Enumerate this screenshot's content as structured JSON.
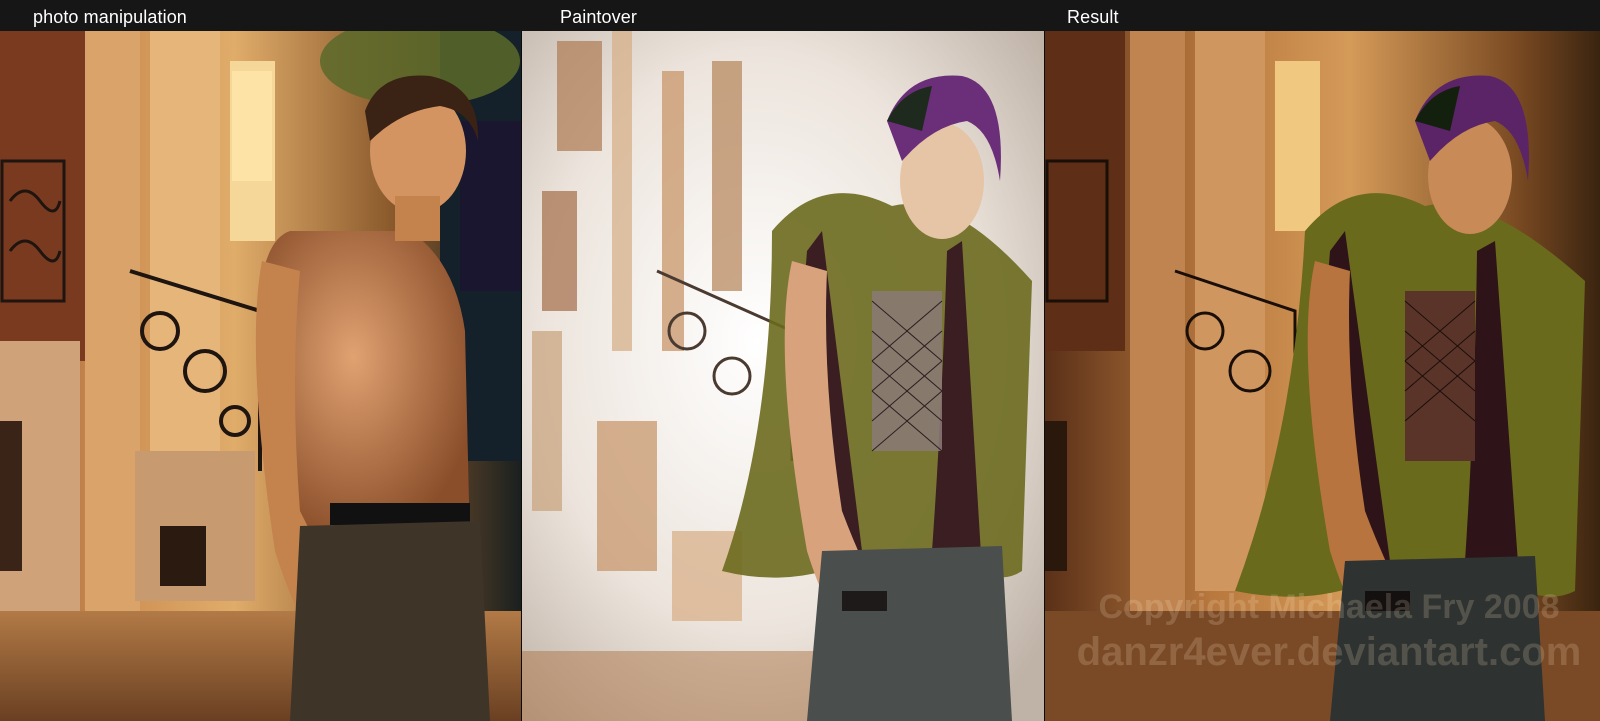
{
  "captions": {
    "photo": "photo manipulation",
    "paintover": "Paintover",
    "result": "Result"
  },
  "watermark": {
    "line1": "Copyright Michaela Fry 2008",
    "line2": "danzr4ever.deviantart.com"
  },
  "colors": {
    "header_bg": "#161616",
    "caption_text": "#ffffff",
    "photo_warm": "#c98a4f",
    "paint_light": "#f2ece6",
    "result_amber": "#b8783e",
    "fur_green": "#8c8a2a",
    "hair_purple": "#6b2f7a"
  }
}
